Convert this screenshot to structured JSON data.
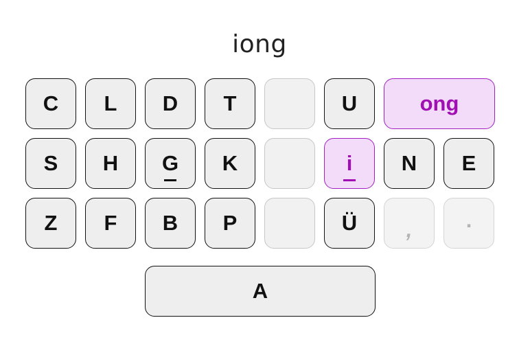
{
  "composition": "iong",
  "accent_color": "#a00fb4",
  "keys": {
    "c": "C",
    "l": "L",
    "d": "D",
    "t": "T",
    "u": "U",
    "ong": "ong",
    "s": "S",
    "h": "H",
    "g": "G",
    "k": "K",
    "i": "i",
    "n": "N",
    "e": "E",
    "z": "Z",
    "f": "F",
    "b": "B",
    "p": "P",
    "uu": "Ü",
    "comma": ",",
    "period": ".",
    "a": "A"
  }
}
